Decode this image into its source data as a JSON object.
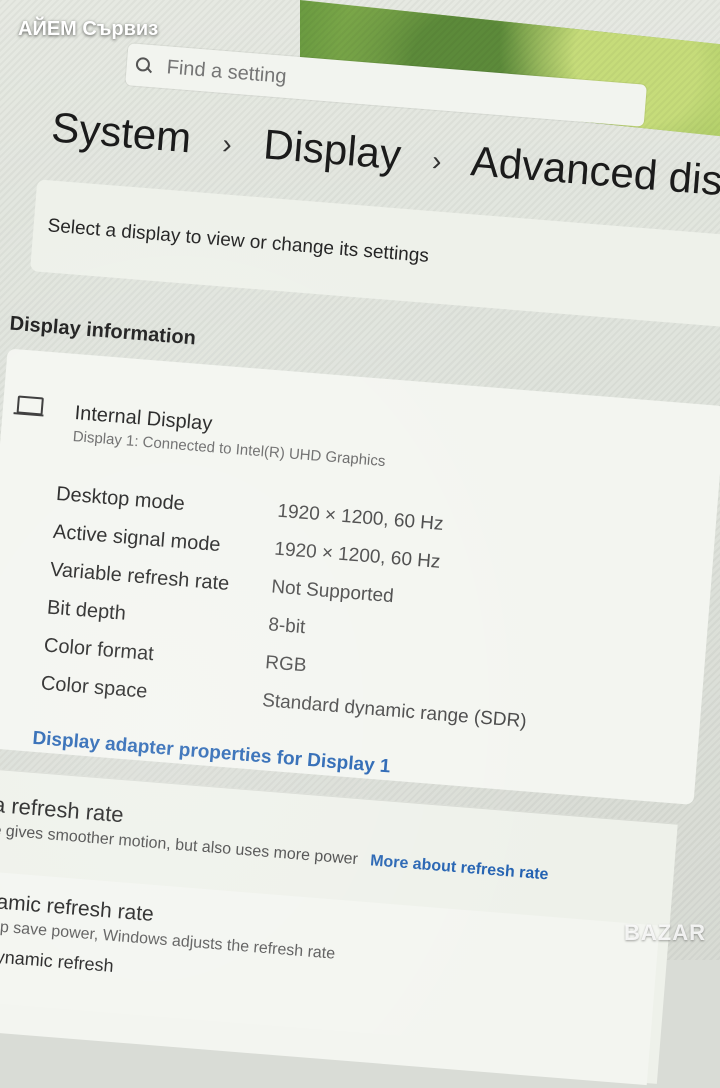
{
  "watermark": "АЙЕМ Сървиз",
  "corner_watermark": "BAZAR",
  "search": {
    "placeholder": "Find a setting"
  },
  "breadcrumb": {
    "items": [
      "System",
      "Display",
      "Advanced displ"
    ]
  },
  "select_display": {
    "text": "Select a display to view or change its settings"
  },
  "display_information": {
    "title": "Display information",
    "display_name": "Internal Display",
    "display_subtitle": "Display 1: Connected to Intel(R) UHD Graphics",
    "properties": [
      {
        "label": "Desktop mode",
        "value": "1920 × 1200, 60 Hz"
      },
      {
        "label": "Active signal mode",
        "value": "1920 × 1200, 60 Hz"
      },
      {
        "label": "Variable refresh rate",
        "value": "Not Supported"
      },
      {
        "label": "Bit depth",
        "value": "8-bit"
      },
      {
        "label": "Color format",
        "value": "RGB"
      },
      {
        "label": "Color space",
        "value": "Standard dynamic range (SDR)"
      }
    ],
    "adapter_link": "Display adapter properties for Display 1"
  },
  "refresh": {
    "title": "hoose a refresh rate",
    "description": "higher rate gives smoother motion, but also uses more power",
    "more_link": "More about refresh rate"
  },
  "dynamic": {
    "title": "Dynamic refresh rate",
    "description": "To help save power, Windows adjusts the refresh rate",
    "note": "Dynamic refresh"
  },
  "colors": {
    "accent": "#1f5fb0"
  },
  "icons": [
    "search-icon",
    "monitor-icon",
    "chevron-right-icon",
    "info-icon"
  ]
}
